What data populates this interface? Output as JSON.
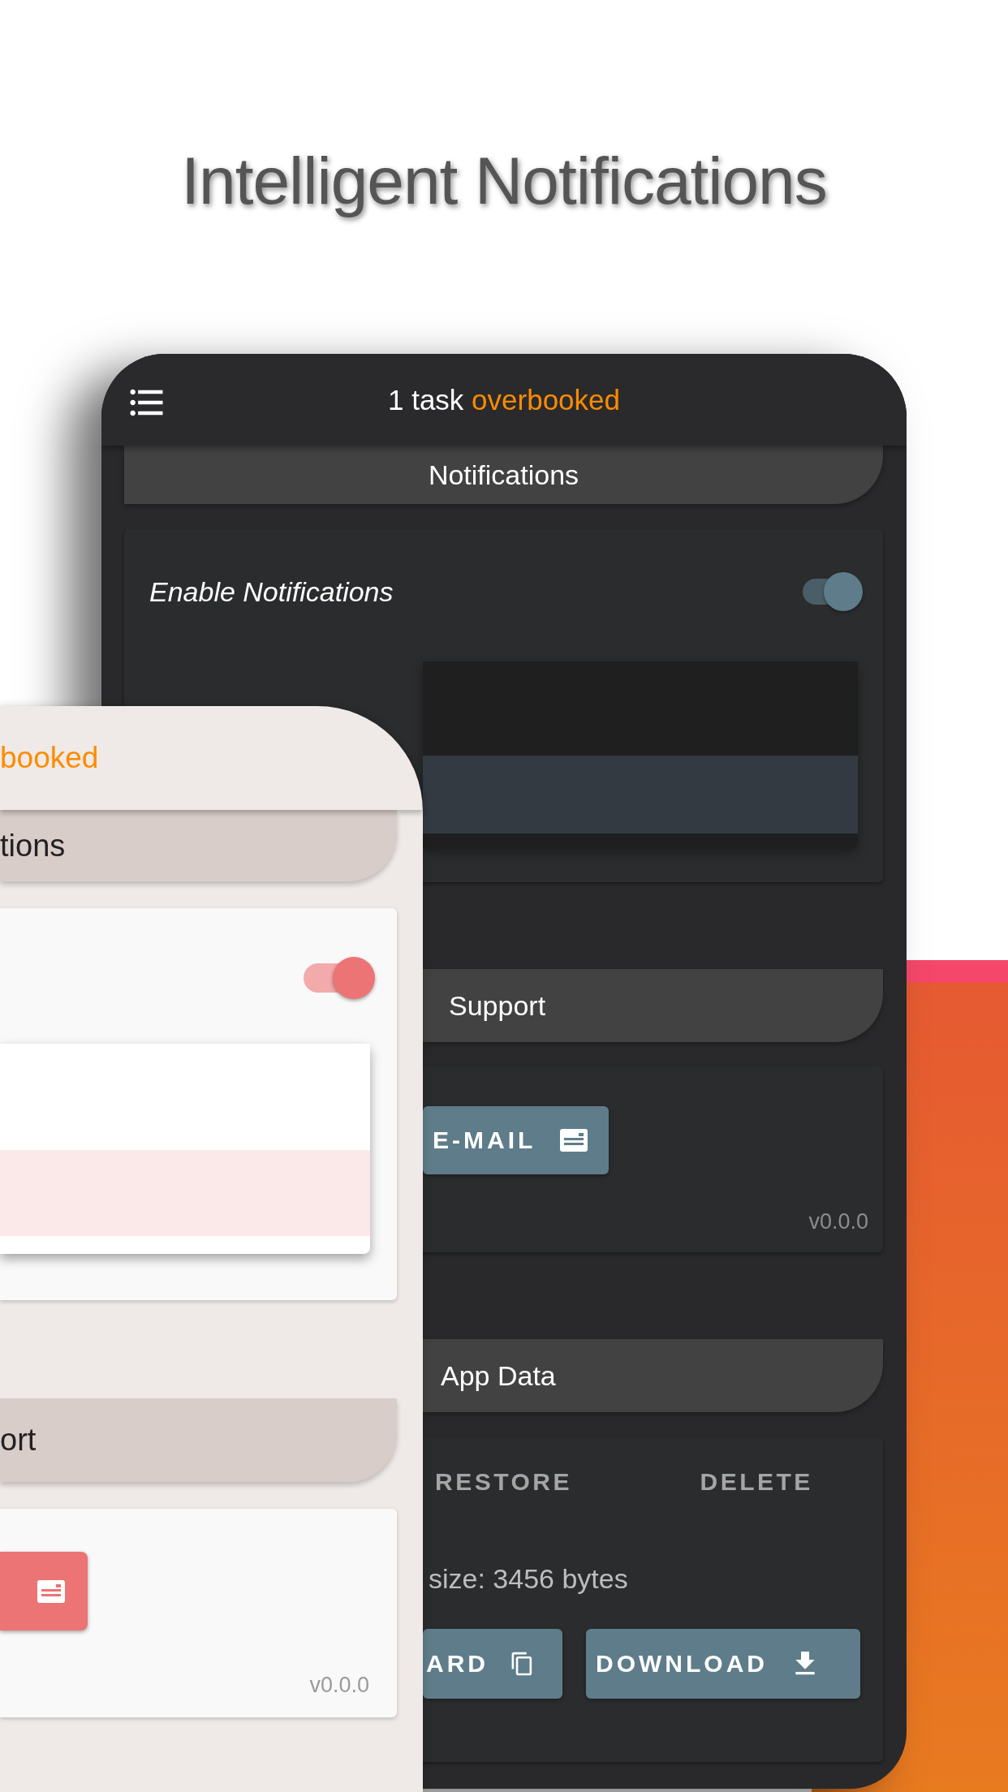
{
  "headline": "Intelligent Notifications",
  "dark_phone": {
    "app_bar": {
      "title": "1 task",
      "highlight": "overbooked"
    },
    "notifications": {
      "header": "Notifications",
      "label": "Enable Notifications",
      "toggle": {
        "on": true
      },
      "menu_rows": [
        {
          "selected": false
        },
        {
          "selected": true
        }
      ]
    },
    "support": {
      "header": "Support",
      "email_button": "E-MAIL",
      "version": "v0.0.0"
    },
    "app_data": {
      "header": "App Data",
      "actions": [
        "RESTORE",
        "DELETE"
      ],
      "size": "size: 3456 bytes",
      "buttons": [
        "ARD",
        "DOWNLOAD"
      ]
    }
  },
  "light_phone": {
    "app_bar": {
      "highlight": "booked"
    },
    "notifications": {
      "header": "tions",
      "toggle": {
        "on": true
      },
      "menu_rows": [
        {
          "selected": false
        },
        {
          "selected": true
        }
      ]
    },
    "support": {
      "header": "ort",
      "version": "v0.0.0"
    }
  }
}
